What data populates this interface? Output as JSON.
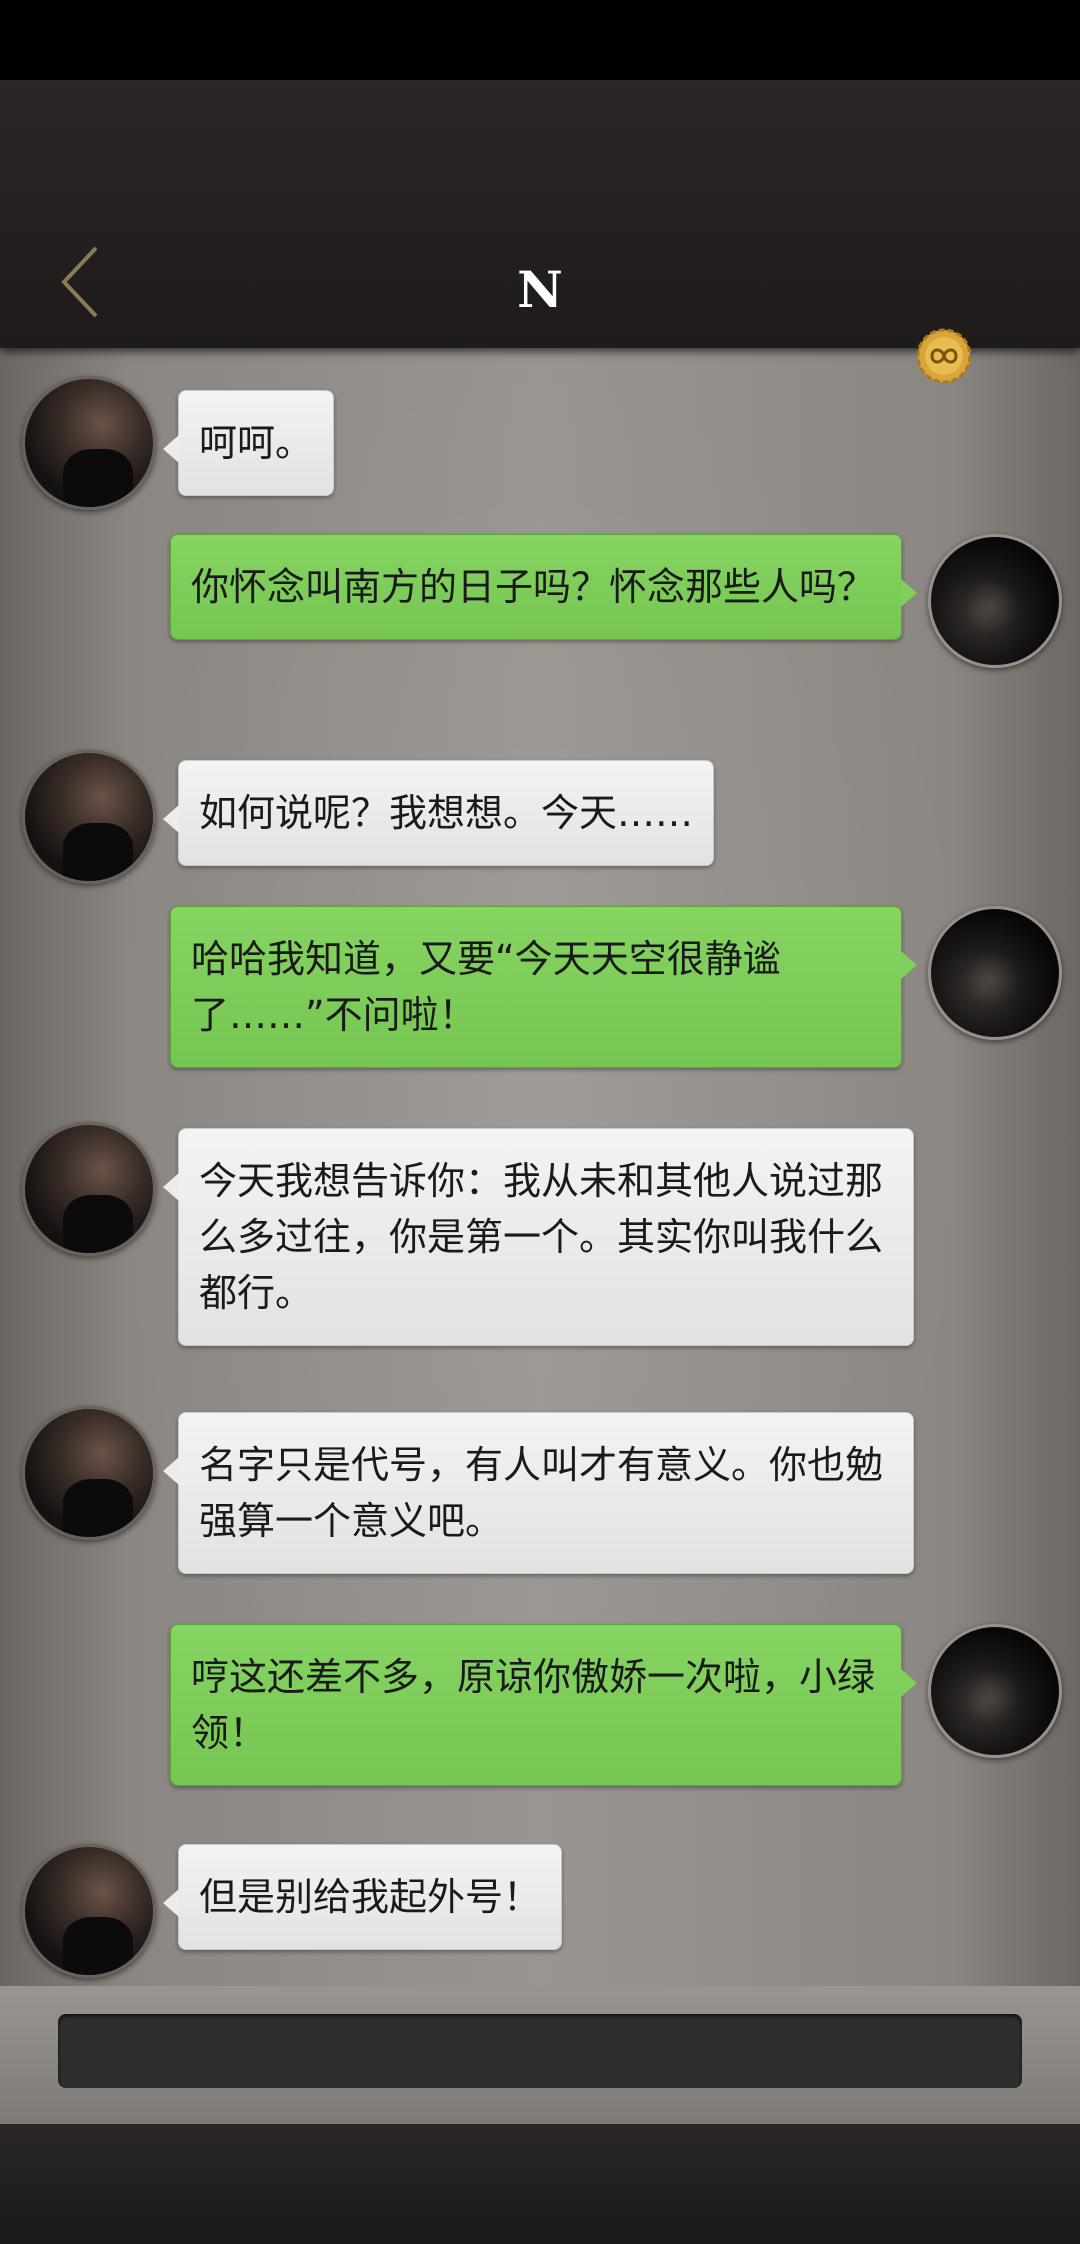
{
  "header": {
    "title": "N",
    "back_icon": "chevron-left-icon",
    "badge_icon": "infinity-seal-icon"
  },
  "messages": [
    {
      "sender": "them",
      "text": "呵呵。"
    },
    {
      "sender": "me",
      "text": "你怀念叫南方的日子吗？怀念那些人吗？"
    },
    {
      "sender": "them",
      "text": "如何说呢？我想想。今天……"
    },
    {
      "sender": "me",
      "text": "哈哈我知道，又要“今天天空很静谧了……”不问啦！"
    },
    {
      "sender": "them",
      "text": "今天我想告诉你：我从未和其他人说过那么多过往，你是第一个。其实你叫我什么都行。"
    },
    {
      "sender": "them",
      "text": "名字只是代号，有人叫才有意义。你也勉强算一个意义吧。"
    },
    {
      "sender": "me",
      "text": "哼这还差不多，原谅你傲娇一次啦，小绿领！"
    },
    {
      "sender": "them",
      "text": "但是别给我起外号！"
    }
  ],
  "input": {
    "value": ""
  },
  "colors": {
    "gold": "#d9a53a",
    "green_bubble": "#7fcb5a",
    "white_bubble": "#ececec"
  }
}
